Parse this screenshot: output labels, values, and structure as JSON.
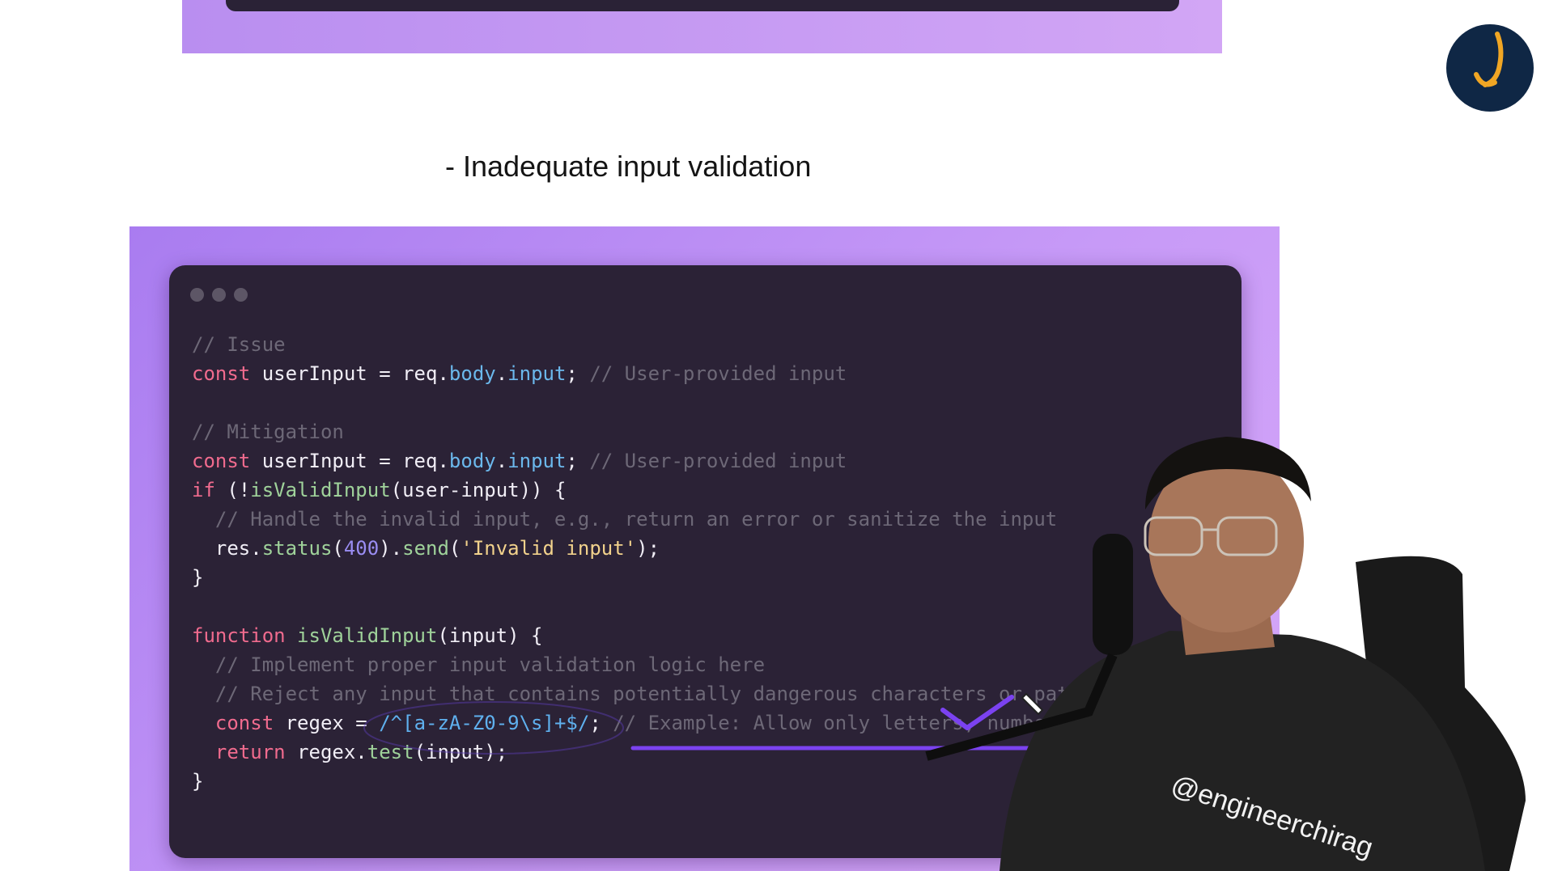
{
  "heading": "- Inadequate input validation",
  "logo": {
    "icon": "hook-logo-icon",
    "bg": "#0f2745",
    "accent": "#f0a624"
  },
  "window": {
    "icon": "window-controls-icon"
  },
  "code": {
    "issue_comment": "// Issue",
    "const_kw": "const",
    "user_input_var": "userInput",
    "assign": " = ",
    "req": "req",
    "dot": ".",
    "body": "body",
    "input_prop": "input",
    "semi_space": "; ",
    "user_provided_comment": "// User-provided input",
    "mitigation_comment": "// Mitigation",
    "if_kw": "if",
    "if_open": " (!",
    "is_valid_input_fn": "isValidInput",
    "if_arg": "(user-input)) {",
    "indent": "  ",
    "handle_comment": "// Handle the invalid input, e.g., return an error or sanitize the input",
    "res_status": "res.",
    "status_fn": "status",
    "paren_open": "(",
    "status_code": "400",
    "paren_close_dot": ").",
    "send_fn": "send",
    "invalid_str": "'Invalid input'",
    "call_end": ");",
    "close_brace": "}",
    "function_kw": "function",
    "fn_params": "(input) {",
    "implement_comment": "// Implement proper input validation logic here",
    "reject_comment": "// Reject any input that contains potentially dangerous characters or patte",
    "regex_var": "regex",
    "regex_literal": "/^[a-zA-Z0-9\\s]+$/",
    "example_comment": "// Example: Allow only letters, numbers,",
    "return_kw": "return",
    "regex_dot": "regex.",
    "test_fn": "test",
    "test_args": "(input);"
  },
  "annotation": {
    "icon": "checkmark-annotation-icon",
    "cursor": "pen-cursor-icon",
    "color": "#7b42f0"
  },
  "presenter": {
    "shirt_text": "@engineerchirag",
    "icon": "presenter-webcam-icon"
  }
}
